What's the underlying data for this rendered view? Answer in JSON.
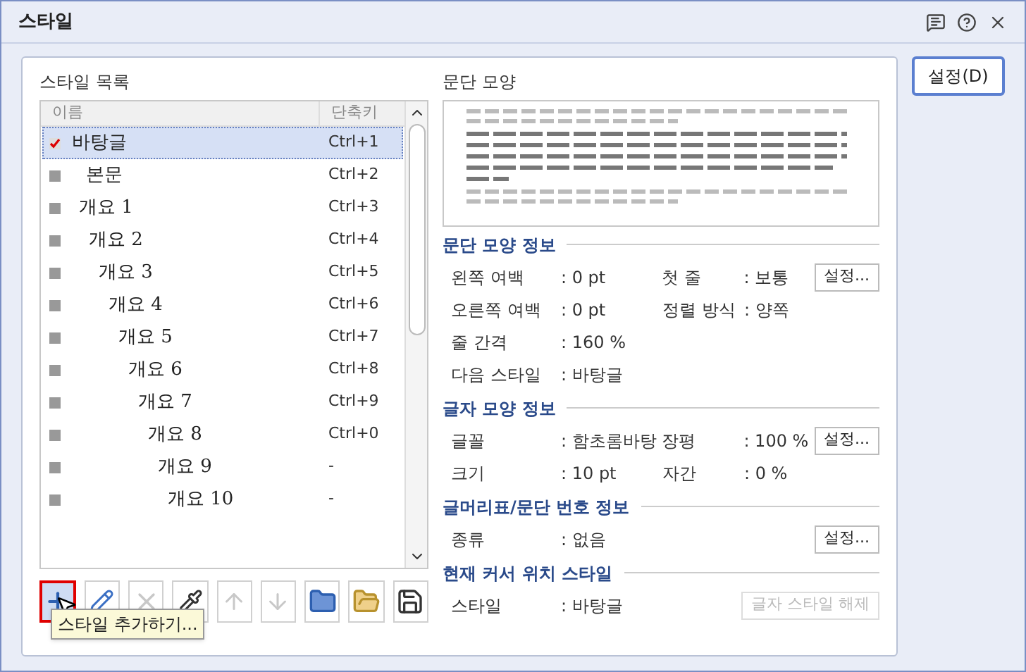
{
  "window": {
    "title": "스타일"
  },
  "settings_button": {
    "label": "설정(D)"
  },
  "style_list": {
    "title": "스타일 목록",
    "columns": [
      "이름",
      "단축키"
    ],
    "items": [
      {
        "name": "바탕글",
        "shortcut": "Ctrl+1",
        "selected": true
      },
      {
        "name": "본문",
        "shortcut": "Ctrl+2",
        "selected": false
      },
      {
        "name": "개요 1",
        "shortcut": "Ctrl+3",
        "selected": false
      },
      {
        "name": "개요 2",
        "shortcut": "Ctrl+4",
        "selected": false
      },
      {
        "name": "개요 3",
        "shortcut": "Ctrl+5",
        "selected": false
      },
      {
        "name": "개요 4",
        "shortcut": "Ctrl+6",
        "selected": false
      },
      {
        "name": "개요 5",
        "shortcut": "Ctrl+7",
        "selected": false
      },
      {
        "name": "개요 6",
        "shortcut": "Ctrl+8",
        "selected": false
      },
      {
        "name": "개요 7",
        "shortcut": "Ctrl+9",
        "selected": false
      },
      {
        "name": "개요 8",
        "shortcut": "Ctrl+0",
        "selected": false
      },
      {
        "name": "개요 9",
        "shortcut": "-",
        "selected": false
      },
      {
        "name": "개요 10",
        "shortcut": "-",
        "selected": false
      }
    ]
  },
  "toolbar": [
    {
      "kind": "add",
      "disabled": false,
      "highlighted": true
    },
    {
      "kind": "edit",
      "disabled": false,
      "highlighted": false
    },
    {
      "kind": "delete",
      "disabled": true,
      "highlighted": false
    },
    {
      "kind": "eyedropper",
      "disabled": false,
      "highlighted": false
    },
    {
      "kind": "up",
      "disabled": true,
      "highlighted": false
    },
    {
      "kind": "down",
      "disabled": true,
      "highlighted": false
    },
    {
      "kind": "import",
      "disabled": false,
      "highlighted": false
    },
    {
      "kind": "open",
      "disabled": false,
      "highlighted": false
    },
    {
      "kind": "save",
      "disabled": false,
      "highlighted": false
    }
  ],
  "tooltip": "스타일 추가하기...",
  "preview": {
    "title": "문단 모양"
  },
  "sections": [
    {
      "title": "문단 모양 정보",
      "rows": [
        {
          "fields": [
            {
              "label": "왼쪽 여백",
              "value": ": 0 pt"
            },
            {
              "label": "첫 줄",
              "value": ": 보통"
            }
          ],
          "button": {
            "label": "설정...",
            "disabled": false
          }
        },
        {
          "fields": [
            {
              "label": "오른쪽 여백",
              "value": ": 0 pt"
            },
            {
              "label": "정렬 방식",
              "value": ": 양쪽"
            }
          ]
        },
        {
          "fields": [
            {
              "label": "줄 간격",
              "value": ": 160 %"
            }
          ]
        },
        {
          "fields": [
            {
              "label": "다음 스타일",
              "value": ": 바탕글"
            }
          ]
        }
      ]
    },
    {
      "title": "글자 모양 정보",
      "rows": [
        {
          "fields": [
            {
              "label": "글꼴",
              "value": ": 함초롬바탕"
            },
            {
              "label": "장평",
              "value": ": 100 %"
            }
          ],
          "button": {
            "label": "설정...",
            "disabled": false
          }
        },
        {
          "fields": [
            {
              "label": "크기",
              "value": ": 10 pt"
            },
            {
              "label": "자간",
              "value": ": 0 %"
            }
          ]
        }
      ]
    },
    {
      "title": "글머리표/문단 번호 정보",
      "rows": [
        {
          "fields": [
            {
              "label": "종류",
              "value": ": 없음"
            }
          ],
          "button": {
            "label": "설정...",
            "disabled": false
          }
        }
      ]
    },
    {
      "title": "현재 커서 위치 스타일",
      "rows": [
        {
          "fields": [
            {
              "label": "스타일",
              "value": ": 바탕글"
            }
          ],
          "button": {
            "label": "글자 스타일 해제",
            "disabled": true
          }
        }
      ]
    }
  ]
}
